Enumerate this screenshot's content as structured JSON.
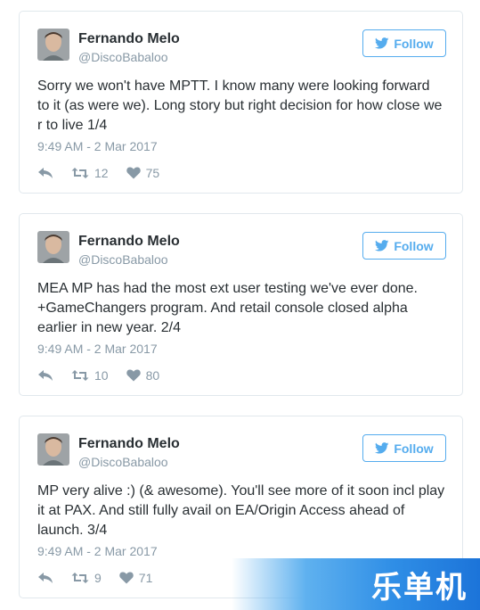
{
  "tweets": [
    {
      "author_name": "Fernando Melo",
      "handle": "@DiscoBabaloo",
      "follow_label": "Follow",
      "text": "Sorry we won't have MPTT. I know many were looking forward\nto it (as were we). Long story but right decision for how close we\nr to live 1/4",
      "timestamp": "9:49 AM - 2 Mar 2017",
      "retweets": "12",
      "likes": "75"
    },
    {
      "author_name": "Fernando Melo",
      "handle": "@DiscoBabaloo",
      "follow_label": "Follow",
      "text": "MEA MP has had the most ext user testing we've ever done.\n+GameChangers program. And retail console closed alpha\nearlier in new year. 2/4",
      "timestamp": "9:49 AM - 2 Mar 2017",
      "retweets": "10",
      "likes": "80"
    },
    {
      "author_name": "Fernando Melo",
      "handle": "@DiscoBabaloo",
      "follow_label": "Follow",
      "text": "MP very alive :) (& awesome). You'll see more of it soon incl play\nit at PAX. And still fully avail on EA/Origin Access ahead of\nlaunch. 3/4",
      "timestamp": "9:49 AM - 2 Mar 2017",
      "retweets": "9",
      "likes": "71"
    }
  ],
  "watermark": {
    "text": "乐单机"
  },
  "icons": {
    "follow": "twitter-bird-icon",
    "reply": "reply-icon",
    "retweet": "retweet-icon",
    "like": "heart-icon"
  },
  "colors": {
    "accent": "#55acee",
    "text": "#292f33",
    "muted": "#8899a6",
    "border": "#e1e8ed"
  }
}
